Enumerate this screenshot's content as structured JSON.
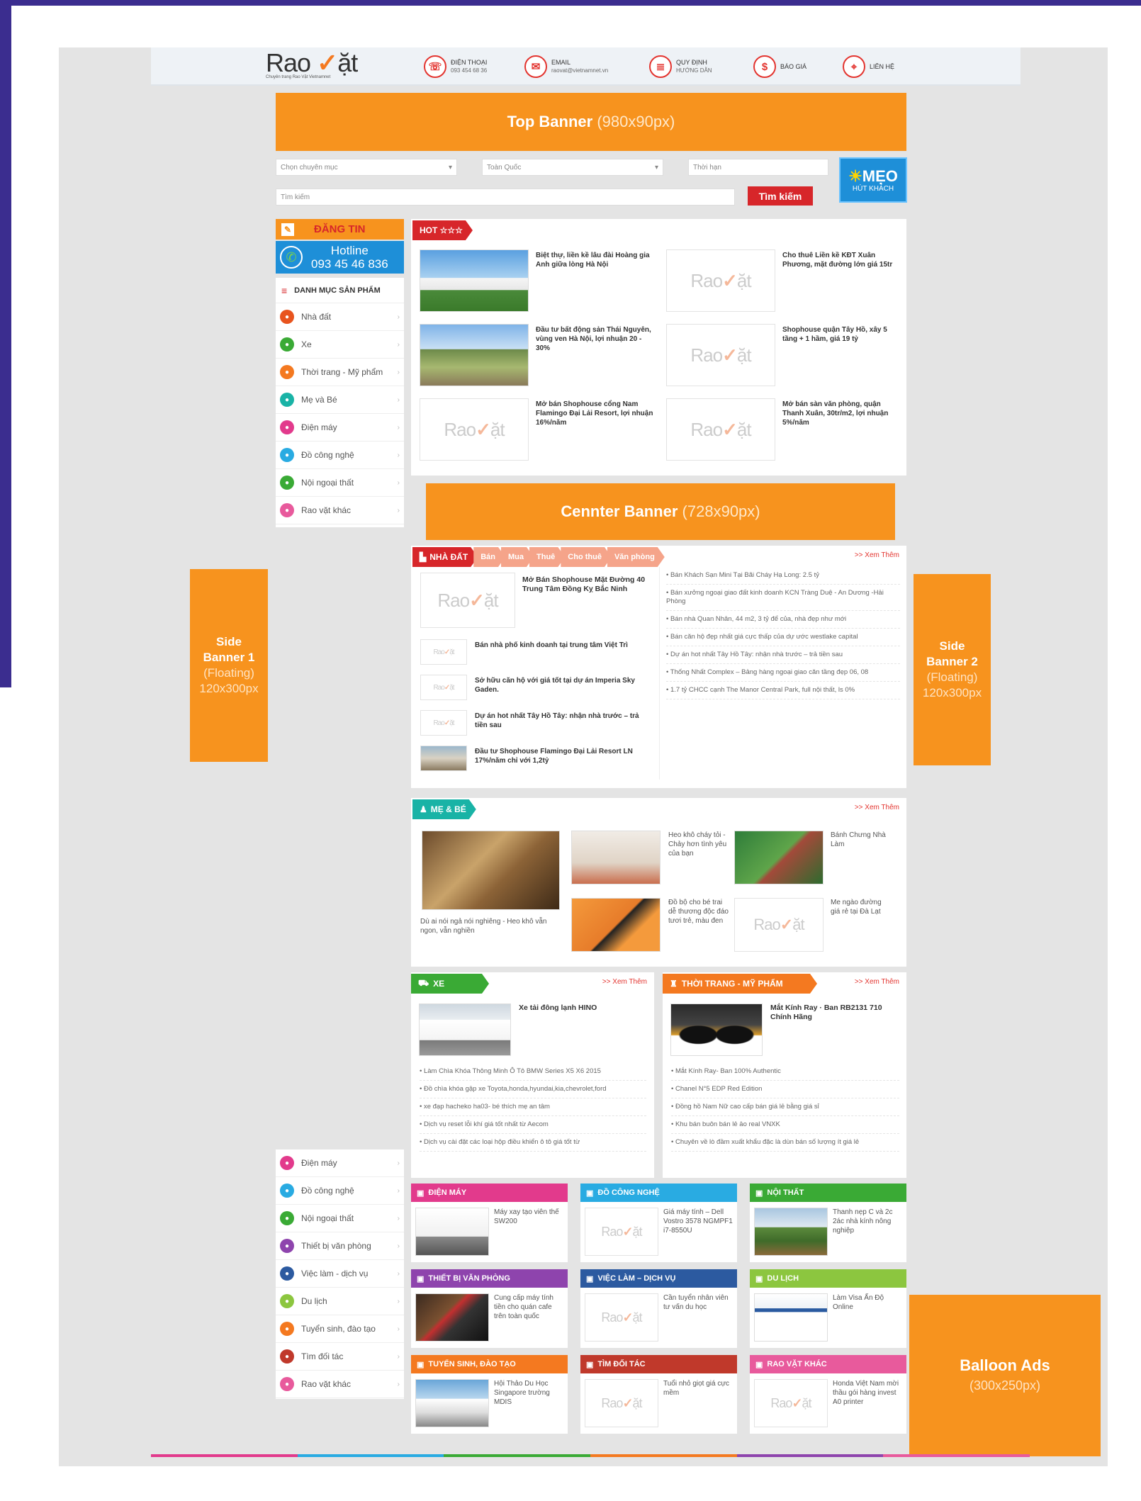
{
  "header": {
    "logo_text": "Rao Vặt",
    "logo_sub": "Chuyên trang Rao Vặt Vietnamnet",
    "items": [
      {
        "icon": "phone-icon",
        "glyph": "☏",
        "title": "ĐIỆN THOẠI",
        "sub": "093 454 68 36"
      },
      {
        "icon": "email-icon",
        "glyph": "✉",
        "title": "EMAIL",
        "sub": "raovat@vietnamnet.vn"
      },
      {
        "icon": "rules-icon",
        "glyph": "≣",
        "title": "QUY ĐỊNH",
        "sub": "HƯỚNG DẪN"
      },
      {
        "icon": "dollar-icon",
        "glyph": "$",
        "title": "BÁO GIÁ",
        "sub": ""
      },
      {
        "icon": "location-icon",
        "glyph": "⌖",
        "title": "LIÊN HỆ",
        "sub": ""
      }
    ]
  },
  "top_banner": {
    "title": "Top Banner",
    "size": "(980x90px)"
  },
  "search": {
    "category_placeholder": "Chọn chuyên mục",
    "location_placeholder": "Toàn Quốc",
    "time_placeholder": "Thời hạn",
    "keyword_placeholder": "Tìm kiếm",
    "button_label": "Tìm kiếm",
    "tip_title": "MẸO",
    "tip_sub": "HÚT KHÁCH"
  },
  "sidebar": {
    "post_label": "ĐĂNG TIN",
    "hotline_label": "Hotline",
    "hotline_number": "093 45 46 836",
    "menu_title": "DANH MỤC SẢN PHẨM",
    "items": [
      {
        "label": "Nhà đất",
        "color": "#e8541e"
      },
      {
        "label": "Xe",
        "color": "#3aaa35"
      },
      {
        "label": "Thời trang - Mỹ phẩm",
        "color": "#f47920"
      },
      {
        "label": "Mẹ và Bé",
        "color": "#19b3a6"
      },
      {
        "label": "Điện máy",
        "color": "#e23a8c"
      },
      {
        "label": "Đồ công nghệ",
        "color": "#29abe2"
      },
      {
        "label": "Nội ngoại thất",
        "color": "#3aaa35"
      },
      {
        "label": "Rao vặt khác",
        "color": "#e85a9c"
      }
    ],
    "items2": [
      {
        "label": "Điện máy",
        "color": "#e23a8c"
      },
      {
        "label": "Đồ công nghệ",
        "color": "#29abe2"
      },
      {
        "label": "Nội ngoại thất",
        "color": "#3aaa35"
      },
      {
        "label": "Thiết bị văn phòng",
        "color": "#8e44ad"
      },
      {
        "label": "Việc làm - dịch vụ",
        "color": "#2c5aa0"
      },
      {
        "label": "Du lịch",
        "color": "#8cc63f"
      },
      {
        "label": "Tuyển sinh, đào tạo",
        "color": "#f47920"
      },
      {
        "label": "Tìm đối tác",
        "color": "#c0392b"
      },
      {
        "label": "Rao vặt khác",
        "color": "#e85a9c"
      }
    ]
  },
  "hot": {
    "label": "HOT ☆☆☆",
    "items": [
      {
        "text": "Biệt thự, liền kề lâu đài Hoàng gia Anh giữa lòng Hà Nội",
        "img": "villa"
      },
      {
        "text": "Cho thuê Liền kề KĐT Xuân Phương, mặt đường lớn giá 15tr",
        "img": "logo"
      },
      {
        "text": "Đầu tư bất động sản Thái Nguyên, vùng ven Hà Nội, lợi nhuận 20 - 30%",
        "img": "gate"
      },
      {
        "text": "Shophouse quận Tây Hồ, xây 5 tầng + 1 hầm, giá 19 tỷ",
        "img": "logo"
      },
      {
        "text": "Mở bán Shophouse cổng Nam Flamingo Đại Lải Resort, lợi nhuận 16%/năm",
        "img": "logo"
      },
      {
        "text": "Mở bán sàn văn phòng, quận Thanh Xuân, 30tr/m2, lợi nhuận 5%/năm",
        "img": "logo"
      }
    ]
  },
  "center_banner": {
    "title": "Cennter Banner",
    "size": "(728x90px)"
  },
  "side_banner_1": {
    "title": "Side Banner 1",
    "sub": "(Floating)",
    "size": "120x300px"
  },
  "side_banner_2": {
    "title": "Side Banner 2",
    "sub": "(Floating)",
    "size": "120x300px"
  },
  "balloon": {
    "title": "Balloon Ads",
    "size": "(300x250px)"
  },
  "nhadat": {
    "tabs": [
      "NHÀ ĐẤT",
      "Bán",
      "Mua",
      "Thuê",
      "Cho thuê",
      "Văn phòng"
    ],
    "more": ">> Xem Thêm",
    "main_title": "Mở Bán Shophouse Mặt Đường 40 Trung Tâm Đồng Kỵ Bắc Ninh",
    "list": [
      "Bán nhà phố kinh doanh tại trung tâm Việt Trì",
      "Sở hữu căn hộ với giá tốt tại dự án Imperia Sky Gaden.",
      "Dự án hot nhất Tây Hồ Tây: nhận nhà trước – trả tiền sau",
      "Đầu tư Shophouse Flamingo Đại Lải Resort LN 17%/năm chỉ với 1,2tỷ"
    ],
    "bullets": [
      "Bán Khách Sạn Mini Tại Bãi Cháy Hạ Long: 2.5 tỷ",
      "Bán xưởng ngoại giao đất kinh doanh KCN Tràng Duệ - An Dương -Hải Phòng",
      "Bán nhà Quan Nhân, 44 m2, 3 tỷ để của, nhà đẹp như mới",
      "Bán căn hộ đẹp nhất giá cực thấp của dự ước westlake capital",
      "Dự án hot nhất Tây Hồ Tây: nhận nhà trước – trả tiền sau",
      "Thống Nhất Complex – Bảng hàng ngoại giao căn tầng đẹp 06, 08",
      "1.7 tỷ CHCC cạnh The Manor Central Park, full nội thất, ls 0%"
    ]
  },
  "mebe": {
    "tab": "MẸ & BÉ",
    "more": ">> Xem Thêm",
    "main_caption": "Dù ai nói ngả nói nghiêng - Heo khô vẫn ngon, vẫn nghiền",
    "items": [
      {
        "text": "Heo khô cháy tỏi - Chảy hơn tình yêu của bạn"
      },
      {
        "text": "Bánh Chưng Nhà Làm"
      },
      {
        "text": "Đồ bộ cho bé trai dễ thương độc đáo tươi trẻ, màu đen"
      },
      {
        "text": "Me ngào đường giá rẻ tại Đà Lạt"
      }
    ]
  },
  "xe": {
    "tab": "XE",
    "more": ">> Xem Thêm",
    "main_title": "Xe tải đông lạnh HINO",
    "bullets": [
      "Làm Chìa Khóa Thông Minh Ô Tô BMW Series X5 X6 2015",
      "Đồ chìa khóa gập xe Toyota,honda,hyundai,kia,chevrolet,ford",
      "xe đạp hacheko ha03- bé thích mẹ an tâm",
      "Dịch vụ reset lỗi khí giá tốt nhất từ Aecom",
      "Dịch vụ cài đặt các loại hộp điều khiển ô tô giá tốt từ"
    ]
  },
  "thoitrang": {
    "tab": "THỜI TRANG - MỸ PHẨM",
    "more": ">> Xem Thêm",
    "main_title": "Mắt Kính Ray · Ban RB2131 710 Chính Hãng",
    "bullets": [
      "Mắt Kính Ray- Ban 100% Authentic",
      "Chanel N°5 EDP Red Edition",
      "Đồng hồ Nam Nữ cao cấp bán giá lẻ bằng giá sỉ",
      "Khu bán buôn bán lẻ ảo real VNXK",
      "Chuyên về lò đầm xuất khẩu đặc là dùn bán số lượng ít giá lẻ"
    ]
  },
  "boxes": [
    {
      "title": "ĐIỆN MÁY",
      "color": "#e23a8c",
      "text": "Máy xay tạo viên thế SW200",
      "img": "machine"
    },
    {
      "title": "ĐỒ CÔNG NGHỆ",
      "color": "#29abe2",
      "text": "Giá máy tính – Dell Vostro 3578 NGMPF1 i7-8550U",
      "img": "logo"
    },
    {
      "title": "NỘI THẤT",
      "color": "#3aaa35",
      "text": "Thanh nẹp C và 2c 2ác nhà kính nông nghiệp",
      "img": "green"
    },
    {
      "title": "THIẾT BỊ VĂN PHÒNG",
      "color": "#8e44ad",
      "text": "Cung cấp máy tính tiền cho quán cafe trên toàn quốc",
      "img": "office"
    },
    {
      "title": "VIỆC LÀM – DỊCH VỤ",
      "color": "#2c5aa0",
      "text": "Cần tuyển nhân viên tư vấn du học",
      "img": "logo"
    },
    {
      "title": "DU LỊCH",
      "color": "#8cc63f",
      "text": "Làm Visa Ấn Độ Online",
      "img": "visa"
    },
    {
      "title": "TUYỂN SINH, ĐÀO TẠO",
      "color": "#f47920",
      "text": "Hội Thảo Du Học Singapore trường MDIS",
      "img": "city"
    },
    {
      "title": "TÌM ĐỐI TÁC",
      "color": "#c0392b",
      "text": "Tuổi nhỏ giọt giá cực mềm",
      "img": "logo"
    },
    {
      "title": "RAO VẶT KHÁC",
      "color": "#e85a9c",
      "text": "Honda Việt Nam mời thầu gói hàng invest A0 printer",
      "img": "logo"
    }
  ],
  "placeholder_logo": "Rao Vặt"
}
